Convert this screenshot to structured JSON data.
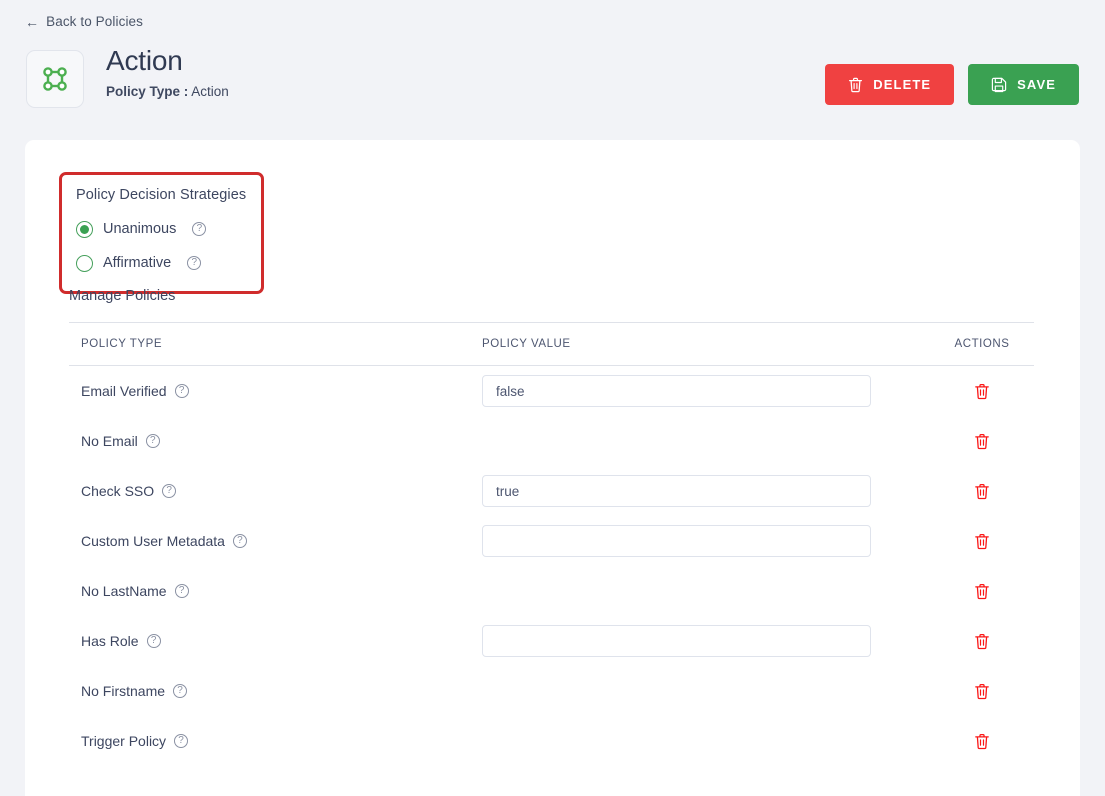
{
  "nav": {
    "back_label": "Back to Policies",
    "back_icon": "arrow-left-icon"
  },
  "header": {
    "icon": "policy-node-graph-icon",
    "title": "Action",
    "subtitle_label": "Policy Type :",
    "subtitle_value": "Action",
    "actions": [
      {
        "label": "DELETE",
        "icon": "trash-icon",
        "color": "#f04141",
        "name": "delete-button"
      },
      {
        "label": "SAVE",
        "icon": "save-floppy-icon",
        "color": "#3aa152",
        "name": "save-button"
      }
    ]
  },
  "strategies": {
    "title": "Policy Decision Strategies",
    "highlight_color": "#d02c2c",
    "accent_color": "#3aa152",
    "options": [
      {
        "label": "Unanimous",
        "selected": true,
        "help_icon": "help-circle-icon"
      },
      {
        "label": "Affirmative",
        "selected": false,
        "help_icon": "help-circle-icon"
      }
    ]
  },
  "manage": {
    "title": "Manage Policies",
    "columns": [
      "POLICY TYPE",
      "POLICY VALUE",
      "ACTIONS"
    ],
    "rows": [
      {
        "type": "Email Verified",
        "has_input": true,
        "value": "false",
        "placeholder": "",
        "help_icon": "help-circle-icon",
        "action_icon": "trash-icon"
      },
      {
        "type": "No Email",
        "has_input": false,
        "value": "",
        "placeholder": "",
        "help_icon": "help-circle-icon",
        "action_icon": "trash-icon"
      },
      {
        "type": "Check SSO",
        "has_input": true,
        "value": "true",
        "placeholder": "",
        "help_icon": "help-circle-icon",
        "action_icon": "trash-icon"
      },
      {
        "type": "Custom User Metadata",
        "has_input": true,
        "value": "",
        "placeholder": "",
        "help_icon": "help-circle-icon",
        "action_icon": "trash-icon"
      },
      {
        "type": "No LastName",
        "has_input": false,
        "value": "",
        "placeholder": "",
        "help_icon": "help-circle-icon",
        "action_icon": "trash-icon"
      },
      {
        "type": "Has Role",
        "has_input": true,
        "value": "",
        "placeholder": "",
        "help_icon": "help-circle-icon",
        "action_icon": "trash-icon"
      },
      {
        "type": "No Firstname",
        "has_input": false,
        "value": "",
        "placeholder": "",
        "help_icon": "help-circle-icon",
        "action_icon": "trash-icon"
      },
      {
        "type": "Trigger Policy",
        "has_input": false,
        "value": "",
        "placeholder": "",
        "help_icon": "help-circle-icon",
        "action_icon": "trash-icon"
      }
    ]
  },
  "glyphs": {
    "help": "?",
    "arrow_left": "←"
  }
}
